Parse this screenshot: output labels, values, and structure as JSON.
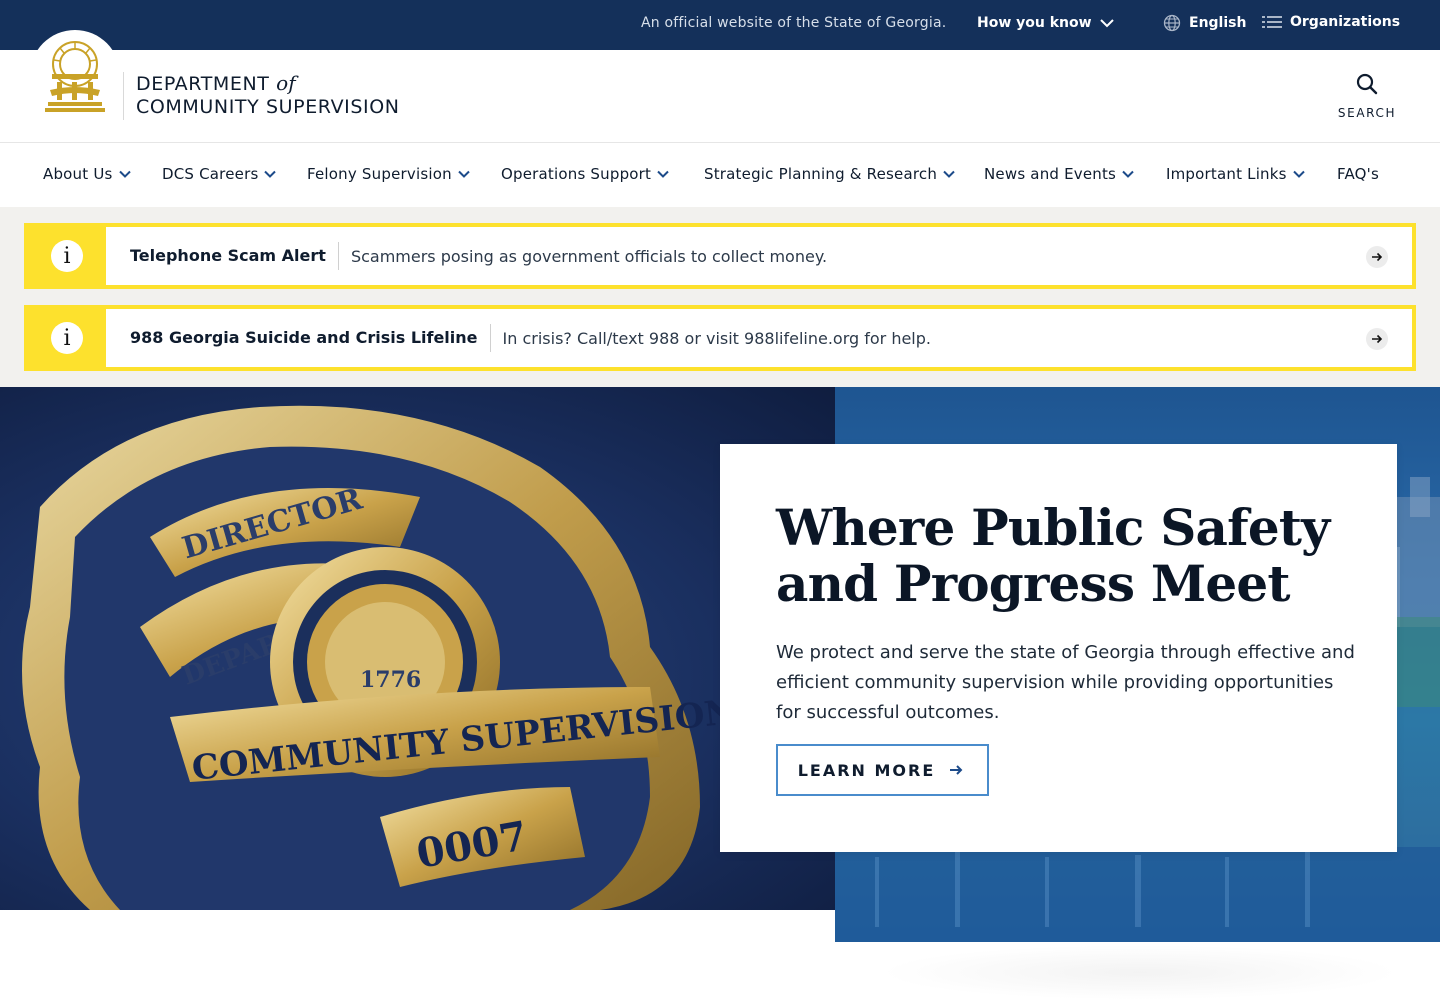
{
  "topbar": {
    "official_text": "An official website of the State of Georgia.",
    "how_you_know": "How you know",
    "language": "English",
    "organizations": "Organizations"
  },
  "header": {
    "brand_line1_a": "DEPARTMENT",
    "brand_line1_b": "of",
    "brand_line2": "COMMUNITY SUPERVISION",
    "search_label": "SEARCH"
  },
  "nav": {
    "items": [
      {
        "label": "About Us"
      },
      {
        "label": "DCS Careers"
      },
      {
        "label": "Felony Supervision"
      },
      {
        "label": "Operations Support"
      },
      {
        "label": "Strategic Planning & Research"
      },
      {
        "label": "News and Events"
      },
      {
        "label": "Important Links"
      },
      {
        "label": "FAQ's"
      }
    ]
  },
  "alerts": [
    {
      "title": "Telephone Scam Alert",
      "message": "Scammers posing as government officials to collect money."
    },
    {
      "title": "988 Georgia Suicide and Crisis Lifeline",
      "message": "In crisis? Call/text 988 or visit 988lifeline.org for help."
    }
  ],
  "hero": {
    "title_line1": "Where Public Safety",
    "title_line2": "and Progress Meet",
    "description": "We protect and serve the state of Georgia through effective and efficient community supervision while providing opportunities for successful outcomes.",
    "cta_label": "LEARN MORE",
    "badge_text_top": "DIRECTOR",
    "badge_text_dept": "DEPARTMENT OF",
    "badge_text_main": "COMMUNITY SUPERVISION",
    "badge_number": "0007",
    "badge_year": "1776"
  },
  "colors": {
    "topbar": "#14305a",
    "alert_yellow": "#fde12d",
    "gold": "#c9a227",
    "cta_border": "#4a8ccc"
  }
}
